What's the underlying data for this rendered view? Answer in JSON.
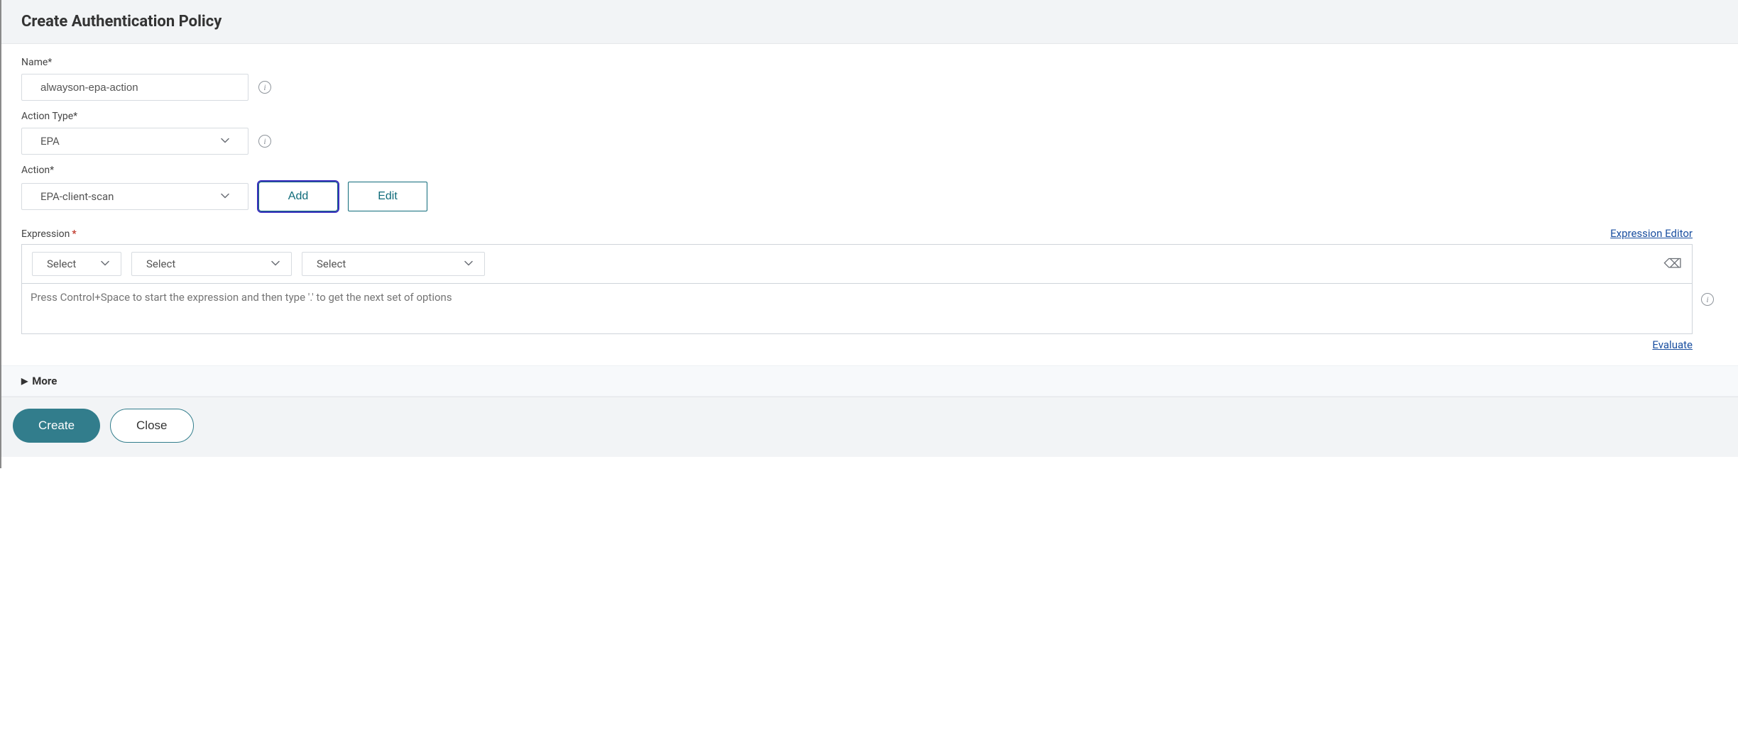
{
  "header": {
    "title": "Create Authentication Policy"
  },
  "fields": {
    "name": {
      "label": "Name*",
      "value": "alwayson-epa-action"
    },
    "action_type": {
      "label": "Action Type*",
      "value": "EPA"
    },
    "action": {
      "label": "Action*",
      "value": "EPA-client-scan",
      "add_label": "Add",
      "edit_label": "Edit"
    },
    "expression": {
      "label": "Expression",
      "editor_link": "Expression Editor",
      "select1": "Select",
      "select2": "Select",
      "select3": "Select",
      "placeholder": "Press Control+Space to start the expression and then type '.' to get the next set of options",
      "evaluate_link": "Evaluate"
    }
  },
  "more": {
    "label": "More"
  },
  "footer": {
    "create_label": "Create",
    "close_label": "Close"
  }
}
